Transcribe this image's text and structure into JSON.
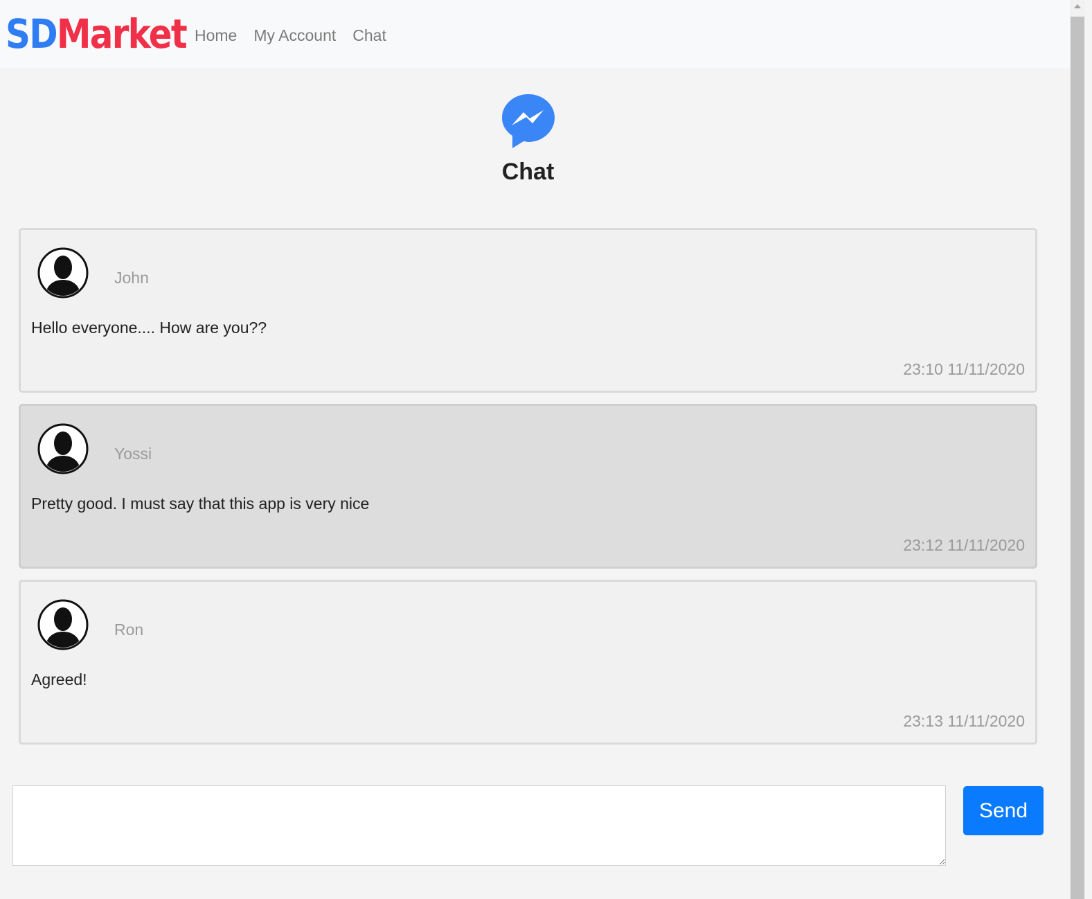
{
  "brand": {
    "part1": "SD",
    "part2": "Market"
  },
  "nav": {
    "home": "Home",
    "account": "My Account",
    "chat": "Chat"
  },
  "page": {
    "title": "Chat",
    "icon": "messenger-icon"
  },
  "messages": [
    {
      "user": "John",
      "text": "Hello everyone.... How are you??",
      "time": "23:10 11/11/2020"
    },
    {
      "user": "Yossi",
      "text": "Pretty good. I must say that this app is very nice",
      "time": "23:12 11/11/2020"
    },
    {
      "user": "Ron",
      "text": "Agreed!",
      "time": "23:13 11/11/2020"
    }
  ],
  "compose": {
    "value": "",
    "send_label": "Send"
  },
  "colors": {
    "brand_blue": "#2f7df3",
    "brand_red": "#f03048",
    "send_button": "#0a7bff",
    "messenger": "#3b86f7"
  }
}
